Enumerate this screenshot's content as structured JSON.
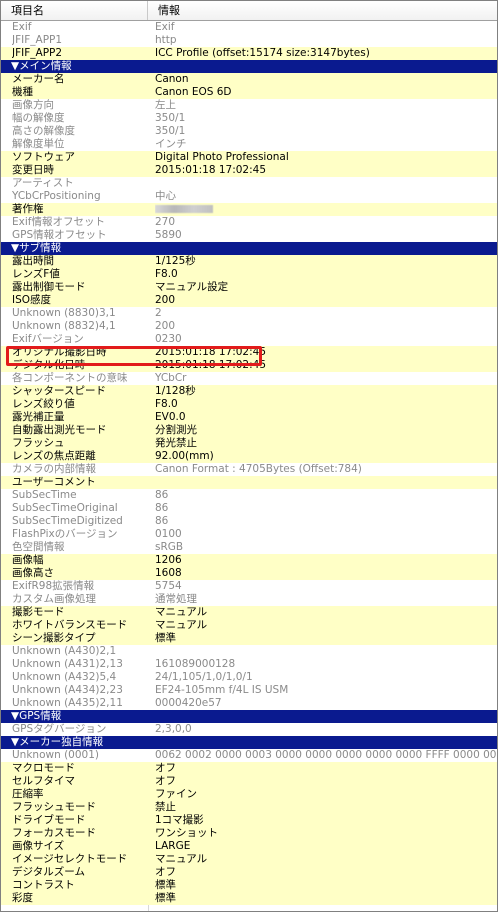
{
  "header": {
    "col_name": "項目名",
    "col_info": "情報"
  },
  "rows": [
    {
      "k": "Exif",
      "v": "Exif",
      "t": "g"
    },
    {
      "k": "JFIF_APP1",
      "v": "http",
      "t": "g"
    },
    {
      "k": "JFIF_APP2",
      "v": "ICC Profile (offset:15174 size:3147bytes)",
      "t": "b"
    },
    {
      "k": "▼メイン情報",
      "v": "",
      "t": "s"
    },
    {
      "k": "メーカー名",
      "v": "Canon",
      "t": "b"
    },
    {
      "k": "機種",
      "v": "Canon EOS 6D",
      "t": "b"
    },
    {
      "k": "画像方向",
      "v": "左上",
      "t": "g"
    },
    {
      "k": "幅の解像度",
      "v": "350/1",
      "t": "g"
    },
    {
      "k": "高さの解像度",
      "v": "350/1",
      "t": "g"
    },
    {
      "k": "解像度単位",
      "v": "インチ",
      "t": "g"
    },
    {
      "k": "ソフトウェア",
      "v": "Digital Photo Professional",
      "t": "b"
    },
    {
      "k": "変更日時",
      "v": "2015:01:18 17:02:45",
      "t": "b"
    },
    {
      "k": "アーティスト",
      "v": "",
      "t": "g"
    },
    {
      "k": "YCbCrPositioning",
      "v": "中心",
      "t": "g"
    },
    {
      "k": "著作権",
      "v": "",
      "t": "b",
      "redacted": true
    },
    {
      "k": "Exif情報オフセット",
      "v": "270",
      "t": "g"
    },
    {
      "k": "GPS情報オフセット",
      "v": "5890",
      "t": "g"
    },
    {
      "k": "▼サブ情報",
      "v": "",
      "t": "s"
    },
    {
      "k": "露出時間",
      "v": "1/125秒",
      "t": "b"
    },
    {
      "k": "レンズF値",
      "v": "F8.0",
      "t": "b"
    },
    {
      "k": "露出制御モード",
      "v": "マニュアル設定",
      "t": "b"
    },
    {
      "k": "ISO感度",
      "v": "200",
      "t": "b"
    },
    {
      "k": "Unknown (8830)3,1",
      "v": "2",
      "t": "g"
    },
    {
      "k": "Unknown (8832)4,1",
      "v": "200",
      "t": "g"
    },
    {
      "k": "Exifバージョン",
      "v": "0230",
      "t": "g"
    },
    {
      "k": "オリジナル撮影日時",
      "v": "2015:01:18 17:02:45",
      "t": "b"
    },
    {
      "k": "デジタル化日時",
      "v": "2015:01:18 17:02:45",
      "t": "b"
    },
    {
      "k": "各コンポーネントの意味",
      "v": "YCbCr",
      "t": "g"
    },
    {
      "k": "シャッタースピード",
      "v": "1/128秒",
      "t": "b"
    },
    {
      "k": "レンズ絞り値",
      "v": "F8.0",
      "t": "b"
    },
    {
      "k": "露光補正量",
      "v": "EV0.0",
      "t": "b"
    },
    {
      "k": "自動露出測光モード",
      "v": "分割測光",
      "t": "b"
    },
    {
      "k": "フラッシュ",
      "v": "発光禁止",
      "t": "b"
    },
    {
      "k": "レンズの焦点距離",
      "v": "92.00(mm)",
      "t": "b"
    },
    {
      "k": "カメラの内部情報",
      "v": "Canon Format : 4705Bytes (Offset:784)",
      "t": "g"
    },
    {
      "k": "ユーザーコメント",
      "v": "",
      "t": "b"
    },
    {
      "k": "SubSecTime",
      "v": "86",
      "t": "g"
    },
    {
      "k": "SubSecTimeOriginal",
      "v": "86",
      "t": "g"
    },
    {
      "k": "SubSecTimeDigitized",
      "v": "86",
      "t": "g"
    },
    {
      "k": "FlashPixのバージョン",
      "v": "0100",
      "t": "g"
    },
    {
      "k": "色空間情報",
      "v": "sRGB",
      "t": "g"
    },
    {
      "k": "画像幅",
      "v": "1206",
      "t": "b"
    },
    {
      "k": "画像高さ",
      "v": "1608",
      "t": "b"
    },
    {
      "k": "ExifR98拡張情報",
      "v": "5754",
      "t": "g"
    },
    {
      "k": "カスタム画像処理",
      "v": "通常処理",
      "t": "g"
    },
    {
      "k": "撮影モード",
      "v": "マニュアル",
      "t": "b"
    },
    {
      "k": "ホワイトバランスモード",
      "v": "マニュアル",
      "t": "b"
    },
    {
      "k": "シーン撮影タイプ",
      "v": "標準",
      "t": "b"
    },
    {
      "k": "Unknown (A430)2,1",
      "v": "",
      "t": "g"
    },
    {
      "k": "Unknown (A431)2,13",
      "v": "161089000128",
      "t": "g"
    },
    {
      "k": "Unknown (A432)5,4",
      "v": "24/1,105/1,0/1,0/1",
      "t": "g"
    },
    {
      "k": "Unknown (A434)2,23",
      "v": "EF24-105mm f/4L IS USM",
      "t": "g"
    },
    {
      "k": "Unknown (A435)2,11",
      "v": "0000420e57",
      "t": "g"
    },
    {
      "k": "▼GPS情報",
      "v": "",
      "t": "s"
    },
    {
      "k": "GPSタグバージョン",
      "v": "2,3,0,0",
      "t": "g"
    },
    {
      "k": "▼メーカー独自情報",
      "v": "",
      "t": "s"
    },
    {
      "k": "Unknown (0001)",
      "v": "0062 0002 0000 0003 0000 0000 0000 0000 0000 FFFF 0000 0001 0",
      "t": "g"
    },
    {
      "k": "マクロモード",
      "v": "オフ",
      "t": "b"
    },
    {
      "k": "セルフタイマ",
      "v": "オフ",
      "t": "b"
    },
    {
      "k": "圧縮率",
      "v": "ファイン",
      "t": "b"
    },
    {
      "k": "フラッシュモード",
      "v": "禁止",
      "t": "b"
    },
    {
      "k": "ドライブモード",
      "v": "1コマ撮影",
      "t": "b"
    },
    {
      "k": "フォーカスモード",
      "v": "ワンショット",
      "t": "b"
    },
    {
      "k": "画像サイズ",
      "v": "LARGE",
      "t": "b"
    },
    {
      "k": "イメージセレクトモード",
      "v": "マニュアル",
      "t": "b"
    },
    {
      "k": "デジタルズーム",
      "v": "オフ",
      "t": "b"
    },
    {
      "k": "コントラスト",
      "v": "標準",
      "t": "b"
    },
    {
      "k": "彩度",
      "v": "標準",
      "t": "b"
    }
  ],
  "colors": {
    "section_bg": "#0a1a8f",
    "highlight_border": "#e21b1b",
    "row_yellow": "#ffffc6"
  }
}
